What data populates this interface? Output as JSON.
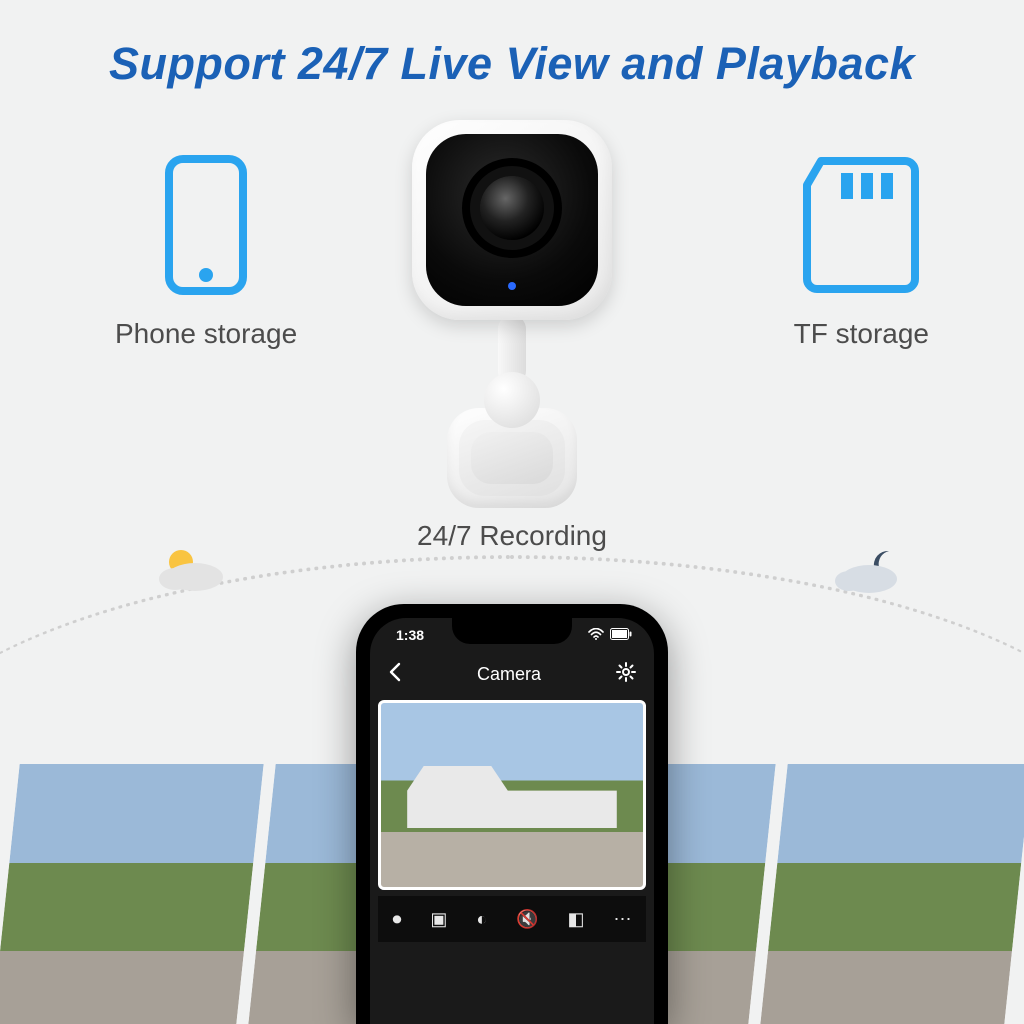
{
  "title": "Support 24/7 Live View and Playback",
  "features": {
    "phone_storage": {
      "label": "Phone storage",
      "icon": "phone-icon"
    },
    "tf_storage": {
      "label": "TF storage",
      "icon": "sd-card-icon"
    }
  },
  "recording_label": "24/7 Recording",
  "phone_mockup": {
    "status_time": "1:38",
    "app_title": "Camera",
    "back_icon": "chevron-left-icon",
    "settings_icon": "gear-icon",
    "signal_icon": "wifi-icon",
    "battery_icon": "battery-icon",
    "toolbar_icons": [
      "record-icon",
      "snapshot-icon",
      "light-icon",
      "mute-icon",
      "talk-icon",
      "more-icon"
    ]
  },
  "colors": {
    "brand_blue": "#1b61b6",
    "icon_blue": "#2aa4ef"
  }
}
